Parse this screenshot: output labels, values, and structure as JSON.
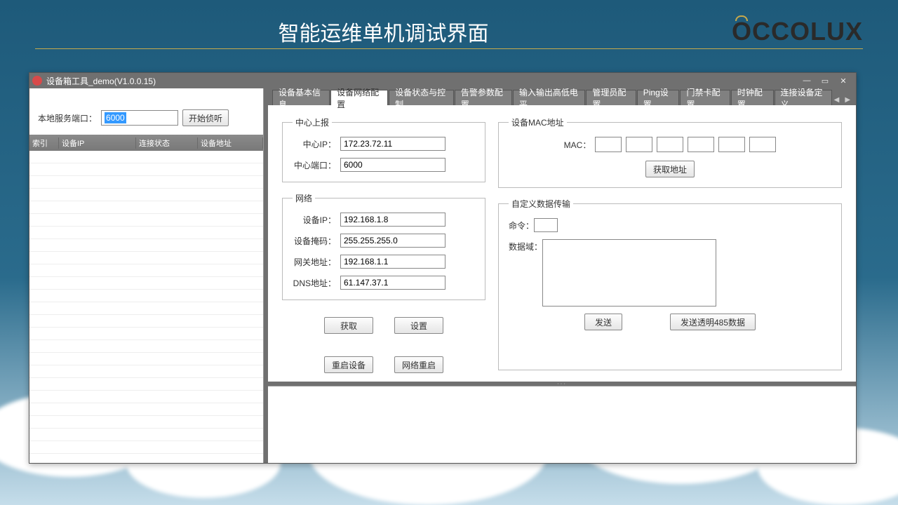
{
  "page": {
    "title": "智能运维单机调试界面",
    "brand": "OCCOLUX"
  },
  "window": {
    "title": "设备箱工具_demo(V1.0.0.15)"
  },
  "left": {
    "port_label": "本地服务端口：",
    "port_value": "6000",
    "listen_btn": "开始侦听",
    "cols": {
      "idx": "索引",
      "ip": "设备IP",
      "status": "连接状态",
      "addr": "设备地址"
    }
  },
  "tabs": [
    "设备基本信息",
    "设备网络配置",
    "设备状态与控制",
    "告警参数配置",
    "输入输出高低电平",
    "管理员配置",
    "Ping设置",
    "门禁卡配置",
    "时钟配置",
    "连接设备定义"
  ],
  "center_report": {
    "legend": "中心上报",
    "ip_label": "中心IP：",
    "ip_value": "172.23.72.11",
    "port_label": "中心端口：",
    "port_value": "6000"
  },
  "network": {
    "legend": "网络",
    "ip_label": "设备IP：",
    "ip_value": "192.168.1.8",
    "mask_label": "设备掩码：",
    "mask_value": "255.255.255.0",
    "gw_label": "网关地址：",
    "gw_value": "192.168.1.1",
    "dns_label": "DNS地址：",
    "dns_value": "61.147.37.1"
  },
  "buttons": {
    "get": "获取",
    "set": "设置",
    "reboot": "重启设备",
    "net_reboot": "网络重启"
  },
  "mac": {
    "legend": "设备MAC地址",
    "label": "MAC：",
    "get_btn": "获取地址"
  },
  "custom": {
    "legend": "自定义数据传输",
    "cmd_label": "命令：",
    "data_label": "数据域：",
    "send": "发送",
    "send485": "发送透明485数据"
  }
}
